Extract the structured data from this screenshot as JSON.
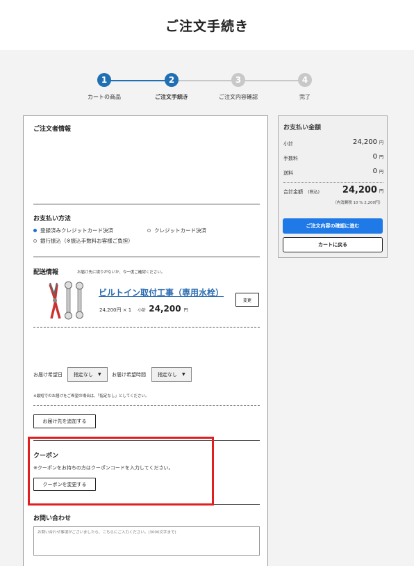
{
  "page_title": "ご注文手続き",
  "steps": [
    {
      "num": "1",
      "label": "カートの商品"
    },
    {
      "num": "2",
      "label": "ご注文手続き"
    },
    {
      "num": "3",
      "label": "ご注文内容確認"
    },
    {
      "num": "4",
      "label": "完了"
    }
  ],
  "colors": {
    "accent": "#1f6fb2",
    "inactive": "#c8c8c8",
    "primary_button": "#1f7ae8",
    "highlight": "#e02020"
  },
  "orderer": {
    "title": "ご注文者情報"
  },
  "payment": {
    "title": "お支払い方法",
    "options": [
      "登録済みクレジットカード決済",
      "クレジットカード決済",
      "銀行振込（※振込手数料お客様ご負担）"
    ],
    "selected": "登録済みクレジットカード決済"
  },
  "shipping": {
    "title": "配送情報",
    "note": "お届け先に誤りがないか、今一度ご確認ください。",
    "product_name": "ビルトイン取付工事（専用水栓）",
    "change_button": "変更",
    "unit_price": "24,200円 × 1",
    "subtotal_label": "小計",
    "subtotal_value": "24,200",
    "yen": "円",
    "delivery_date_label": "お届け希望日",
    "delivery_date_value": "指定なし",
    "delivery_time_label": "お届け希望時間",
    "delivery_time_value": "指定なし",
    "delivery_note": "※最短でのお届けをご希望の場合は、「指定なし」としてください。",
    "add_address_button": "お届け先を追加する"
  },
  "coupon": {
    "title": "クーポン",
    "note": "※クーポンをお持ちの方はクーポンコードを入力してください。",
    "button": "クーポンを変更する"
  },
  "inquiry": {
    "title": "お問い合わせ",
    "placeholder": "お問い合わせ事項がございましたら、こちらにご入力ください。(3000文字まで)"
  },
  "summary": {
    "title": "お支払い金額",
    "subtotal_label": "小計",
    "subtotal_value": "24,200",
    "fee_label": "手数料",
    "fee_value": "0",
    "shipping_label": "送料",
    "shipping_value": "0",
    "total_label": "合計金額",
    "tax_label": "(税込)",
    "total_value": "24,200",
    "yen": "円",
    "tax_note": "（内消費税 10 % 2,200円）",
    "confirm_button": "ご注文内容の確認に進む",
    "back_button": "カートに戻る"
  }
}
